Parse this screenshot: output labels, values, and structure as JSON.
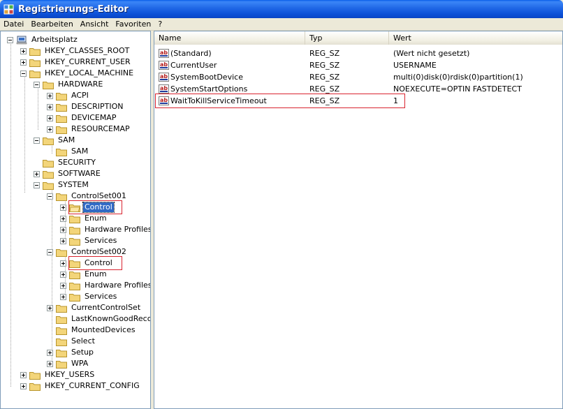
{
  "window": {
    "title": "Registrierungs-Editor",
    "icon": "registry-editor-icon"
  },
  "menu": [
    "Datei",
    "Bearbeiten",
    "Ansicht",
    "Favoriten",
    "?"
  ],
  "tree": {
    "root": "Arbeitsplatz",
    "hkcr": "HKEY_CLASSES_ROOT",
    "hkcu": "HKEY_CURRENT_USER",
    "hklm": "HKEY_LOCAL_MACHINE",
    "hardware": "HARDWARE",
    "acpi": "ACPI",
    "description": "DESCRIPTION",
    "devicemap": "DEVICEMAP",
    "resourcemap": "RESOURCEMAP",
    "sam": "SAM",
    "sam_sub": "SAM",
    "security": "SECURITY",
    "software": "SOFTWARE",
    "system": "SYSTEM",
    "cs001": "ControlSet001",
    "cs001_control": "Control",
    "cs001_enum": "Enum",
    "cs001_hwprofiles": "Hardware Profiles",
    "cs001_services": "Services",
    "cs002": "ControlSet002",
    "cs002_control": "Control",
    "cs002_enum": "Enum",
    "cs002_hwprofiles": "Hardware Profiles",
    "cs002_services": "Services",
    "currentcontrolset": "CurrentControlSet",
    "lastknowngood": "LastKnownGoodRecove",
    "mounteddevices": "MountedDevices",
    "select": "Select",
    "setup": "Setup",
    "wpa": "WPA",
    "hku": "HKEY_USERS",
    "hkcc": "HKEY_CURRENT_CONFIG"
  },
  "list": {
    "columns": [
      "Name",
      "Typ",
      "Wert"
    ],
    "rows": [
      {
        "name": "(Standard)",
        "type": "REG_SZ",
        "value": "(Wert nicht gesetzt)"
      },
      {
        "name": "CurrentUser",
        "type": "REG_SZ",
        "value": "USERNAME"
      },
      {
        "name": "SystemBootDevice",
        "type": "REG_SZ",
        "value": "multi(0)disk(0)rdisk(0)partition(1)"
      },
      {
        "name": "SystemStartOptions",
        "type": "REG_SZ",
        "value": "NOEXECUTE=OPTIN  FASTDETECT"
      },
      {
        "name": "WaitToKillServiceTimeout",
        "type": "REG_SZ",
        "value": "1"
      }
    ]
  },
  "colors": {
    "highlight": "#d9242f",
    "selection": "#316ac5",
    "folder": "#f3d57a"
  }
}
